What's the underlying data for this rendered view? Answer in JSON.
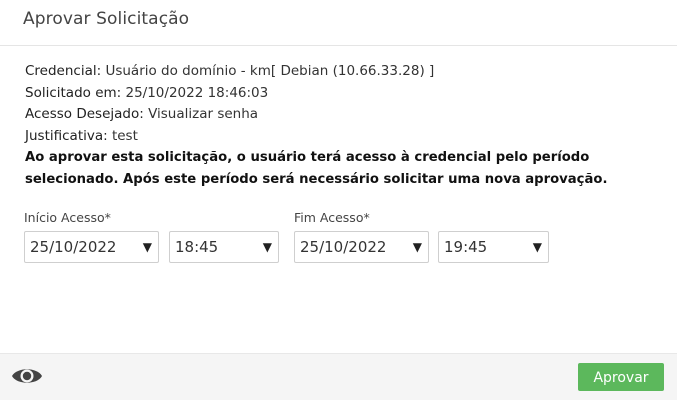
{
  "dialog": {
    "title": "Aprovar Solicitação"
  },
  "info": {
    "credencial_label": "Credencial:",
    "credencial_value": " Usuário do domínio - km[ Debian (10.66.33.28) ]",
    "solicitado_label": "Solicitado em:",
    "solicitado_value": " 25/10/2022 18:46:03",
    "acesso_label": "Acesso Desejado:",
    "acesso_value": " Visualizar senha",
    "justificativa_label": "Justificativa:",
    "justificativa_value": " test",
    "warning": "Ao aprovar esta solicitação, o usuário terá acesso à credencial pelo período selecionado. Após este período será necessário solicitar uma nova aprovação."
  },
  "inicio": {
    "label": "Início Acesso*",
    "date": "25/10/2022",
    "time": "18:45"
  },
  "fim": {
    "label": "Fim Acesso*",
    "date": "25/10/2022",
    "time": "19:45"
  },
  "icons": {
    "dropdown": "▼",
    "eye": "eye-icon"
  },
  "footer": {
    "approve_label": "Aprovar"
  },
  "colors": {
    "approve_button": "#5cb85c"
  }
}
